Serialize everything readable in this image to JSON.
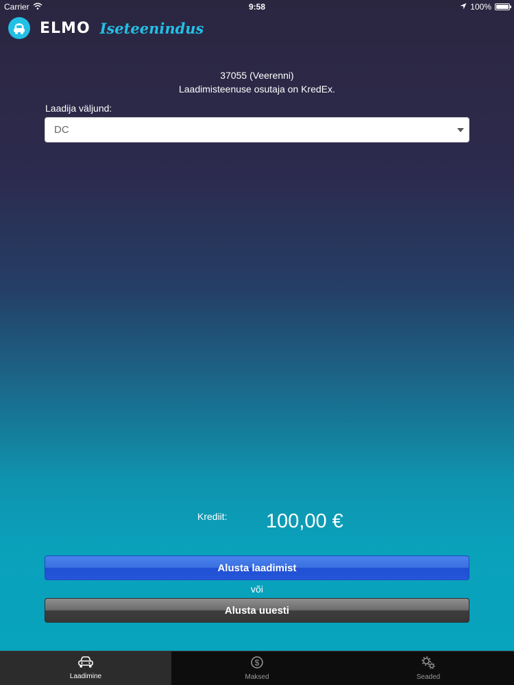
{
  "status_bar": {
    "carrier": "Carrier",
    "time": "9:58",
    "battery": "100%",
    "battery_level": 1.0
  },
  "header": {
    "brand": "ELMO",
    "subtitle": "Iseteenindus",
    "accent_color": "#23c0e6"
  },
  "station": {
    "name": "37055 (Veerenni)",
    "provider_note": "Laadimisteenuse osutaja on KredEx."
  },
  "connector": {
    "label": "Laadija väljund:",
    "selected": "DC"
  },
  "credit": {
    "label": "Krediit:",
    "value": "100,00 €"
  },
  "actions": {
    "start_label": "Alusta laadimist",
    "or_label": "või",
    "restart_label": "Alusta uuesti",
    "start_color": "#2556d8",
    "restart_color": "#363636"
  },
  "tabs": [
    {
      "label": "Laadimine",
      "icon": "car-icon",
      "active": true
    },
    {
      "label": "Maksed",
      "icon": "dollar-icon",
      "active": false
    },
    {
      "label": "Seaded",
      "icon": "gears-icon",
      "active": false
    }
  ]
}
